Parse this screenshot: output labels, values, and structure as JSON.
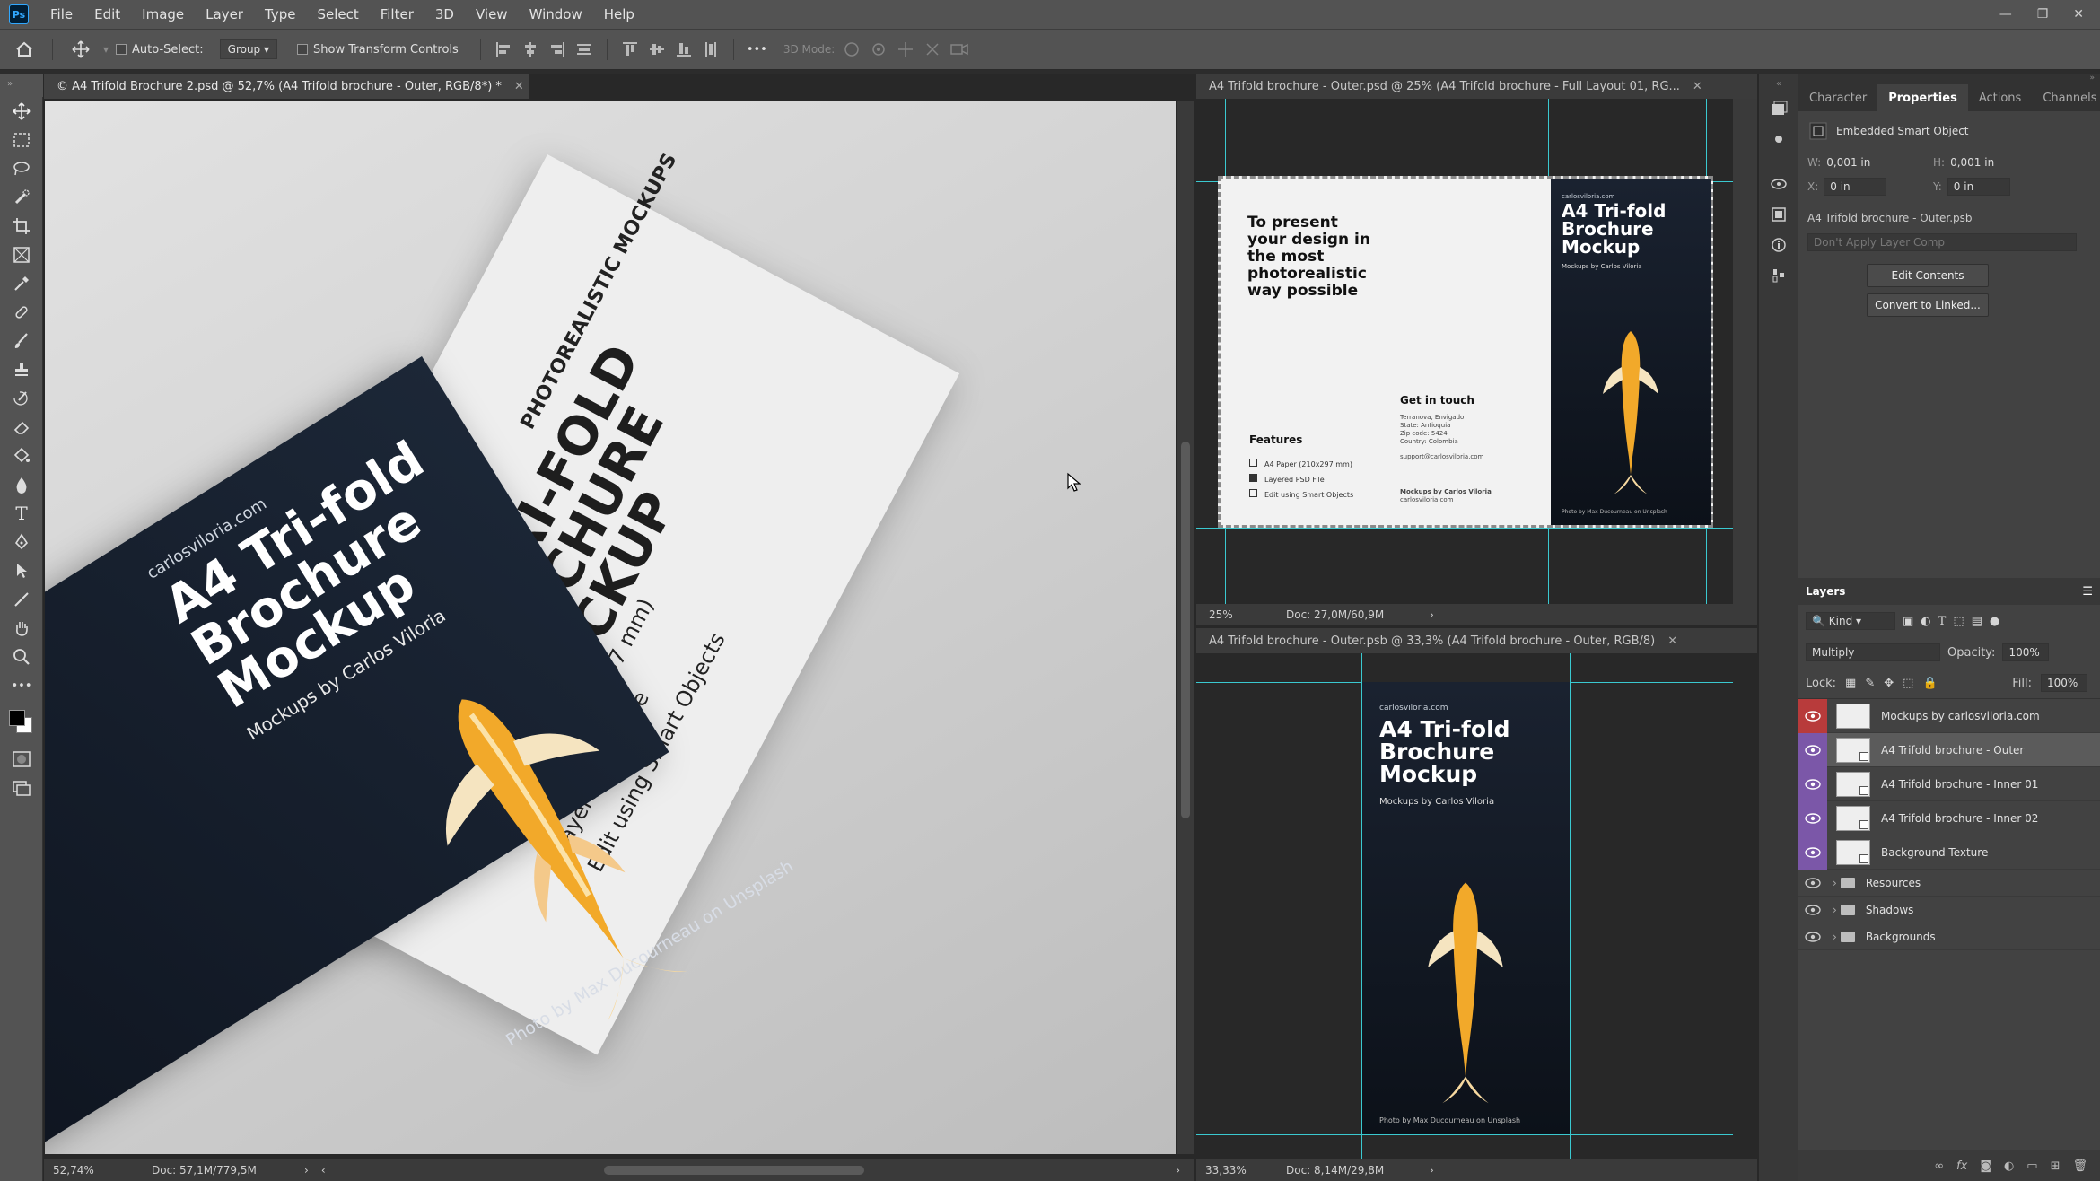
{
  "menubar": {
    "logo": "Ps",
    "items": [
      "File",
      "Edit",
      "Image",
      "Layer",
      "Type",
      "Select",
      "Filter",
      "3D",
      "View",
      "Window",
      "Help"
    ]
  },
  "options": {
    "auto_select_label": "Auto-Select:",
    "auto_select_value": "Group",
    "transform_label": "Show Transform Controls",
    "more": "•••",
    "mode_label": "3D Mode:"
  },
  "doc_main": {
    "tab_title": "© A4 Trifold Brochure 2.psd @ 52,7% (A4 Trifold brochure - Outer, RGB/8*) *",
    "zoom": "52,74%",
    "doc_size": "Doc: 57,1M/779,5M",
    "navy_cover": {
      "site": "carlosviloria.com",
      "title_1": "A4 Tri-fold",
      "title_2": "Brochure",
      "title_3": "Mockup",
      "byline": "Mockups by Carlos Viloria",
      "credit": "Photo by Max Ducourneau on Unsplash"
    },
    "white_panel": {
      "photoreal": "PHOTOREALISTIC MOCKUPS",
      "big_1": "A4 TRI-FOLD",
      "big_2": "BROCHURE",
      "big_3": "MOCKUP",
      "feat_1": "A4 Paper (210x297 mm)",
      "feat_2": "Layered PSD File",
      "feat_3": "Edit using Smart Objects"
    }
  },
  "doc_top": {
    "tab_title": "A4 Trifold brochure - Outer.psd @ 25% (A4 Trifold brochure - Full Layout 01, RG...",
    "zoom": "25%",
    "doc_size": "Doc: 27,0M/60,9M",
    "intro": "To present your design in the most photorealistic way possible",
    "features_title": "Features",
    "features": [
      "A4 Paper (210x297 mm)",
      "Layered PSD File",
      "Edit using Smart Objects"
    ],
    "contact_title": "Get in touch",
    "contact_lines": [
      "Terranova, Envigado",
      "State: Antioquia",
      "Zip code: 5424",
      "Country: Colombia"
    ],
    "email": "support@carlosviloria.com",
    "mockups_by": "Mockups by Carlos Viloria",
    "mockups_site": "carlosviloria.com",
    "cover_site": "carlosviloria.com",
    "cover_title_1": "A4 Tri-fold",
    "cover_title_2": "Brochure",
    "cover_title_3": "Mockup",
    "cover_byline": "Mockups by Carlos Viloria",
    "cover_credit": "Photo by Max Ducourneau on Unsplash"
  },
  "doc_bottom": {
    "tab_title": "A4 Trifold brochure - Outer.psb @ 33,3% (A4 Trifold brochure - Outer, RGB/8)",
    "zoom": "33,33%",
    "doc_size": "Doc: 8,14M/29,8M",
    "site": "carlosviloria.com",
    "title_1": "A4 Tri-fold",
    "title_2": "Brochure",
    "title_3": "Mockup",
    "byline": "Mockups by Carlos Viloria",
    "credit": "Photo by Max Ducourneau on Unsplash"
  },
  "properties": {
    "tabs": [
      "Character",
      "Properties",
      "Actions",
      "Channels"
    ],
    "active_tab": "Properties",
    "object_type": "Embedded Smart Object",
    "w_label": "W:",
    "w_value": "0,001 in",
    "h_label": "H:",
    "h_value": "0,001 in",
    "x_label": "X:",
    "x_value": "0 in",
    "y_label": "Y:",
    "y_value": "0 in",
    "file_name": "A4 Trifold brochure - Outer.psb",
    "layer_comp": "Don't Apply Layer Comp",
    "edit_contents": "Edit Contents",
    "convert_linked": "Convert to Linked..."
  },
  "layers": {
    "title": "Layers",
    "kind": "Kind",
    "blend_mode": "Multiply",
    "opacity_label": "Opacity:",
    "opacity_value": "100%",
    "lock_label": "Lock:",
    "fill_label": "Fill:",
    "fill_value": "100%",
    "items": [
      {
        "name": "Mockups by carlosviloria.com",
        "kind": "layer",
        "tag_color": "#b83b3b"
      },
      {
        "name": "A4 Trifold brochure - Outer",
        "kind": "smart",
        "tag_color": "#7b57a8",
        "selected": true
      },
      {
        "name": "A4 Trifold brochure - Inner 01",
        "kind": "smart",
        "tag_color": "#7b57a8"
      },
      {
        "name": "A4 Trifold brochure - Inner 02",
        "kind": "smart",
        "tag_color": "#7b57a8"
      },
      {
        "name": "Background Texture",
        "kind": "smart",
        "tag_color": "#7b57a8"
      },
      {
        "name": "Resources",
        "kind": "group"
      },
      {
        "name": "Shadows",
        "kind": "group"
      },
      {
        "name": "Backgrounds",
        "kind": "group"
      }
    ]
  },
  "colors": {
    "guide": "#3ac9d0",
    "red_tag": "#b83b3b",
    "violet_tag": "#7b57a8",
    "fish": "#f2a92a"
  }
}
